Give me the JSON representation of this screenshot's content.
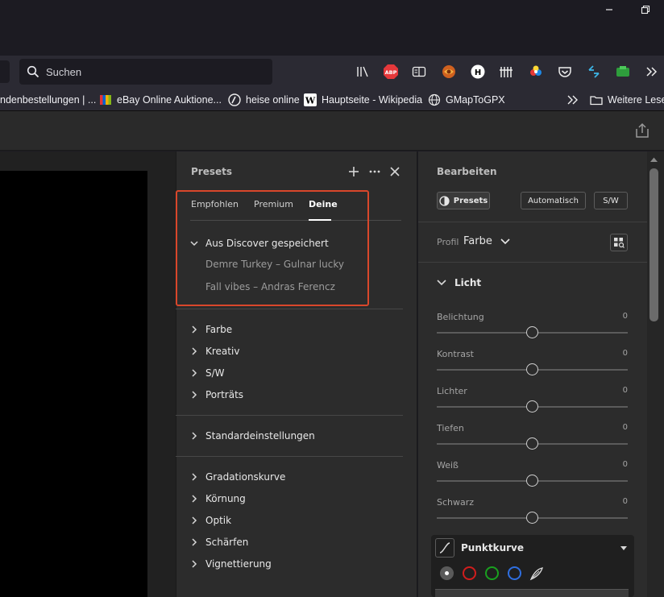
{
  "browser": {
    "window_controls": [
      "minimize-icon",
      "restore-icon"
    ],
    "search": {
      "placeholder": "Suchen"
    },
    "toolbar_icons": [
      "library-icon",
      "adblock-plus-icon",
      "reader-view-icon",
      "extension-icon",
      "extension-h-icon",
      "extension-grid-icon",
      "extension-color-icon",
      "pocket-icon",
      "sync-icon",
      "extension-green-icon",
      "overflow-chevrons-icon"
    ],
    "bookmarks": [
      {
        "label": "ndenbestellungen | ...",
        "icon": "none"
      },
      {
        "label": "eBay Online Auktione...",
        "icon": "ebay-icon"
      },
      {
        "label": "heise online",
        "icon": "heise-icon"
      },
      {
        "label": "Hauptseite - Wikipedia",
        "icon": "wikipedia-icon"
      },
      {
        "label": "GMapToGPX",
        "icon": "globe-icon"
      },
      {
        "label": "Weitere Lesez",
        "icon": "folder-icon"
      }
    ]
  },
  "presets": {
    "title": "Presets",
    "tabs": [
      {
        "label": "Empfohlen",
        "active": false
      },
      {
        "label": "Premium",
        "active": false
      },
      {
        "label": "Deine",
        "active": true
      }
    ],
    "discover_group": {
      "label": "Aus Discover gespeichert",
      "items": [
        "Demre Turkey – Gulnar lucky",
        "Fall vibes – Andras Ferencz"
      ]
    },
    "groups_a": [
      "Farbe",
      "Kreativ",
      "S/W",
      "Porträts"
    ],
    "groups_b": [
      "Standardeinstellungen"
    ],
    "groups_c": [
      "Gradationskurve",
      "Körnung",
      "Optik",
      "Schärfen",
      "Vignettierung"
    ],
    "highlight_color": "#d9472b"
  },
  "edit": {
    "title": "Bearbeiten",
    "buttons": {
      "presets": "Presets",
      "auto": "Automatisch",
      "bw": "S/W"
    },
    "profile": {
      "label": "Profil",
      "value": "Farbe"
    },
    "light": {
      "title": "Licht",
      "sliders": [
        {
          "label": "Belichtung",
          "value": "0"
        },
        {
          "label": "Kontrast",
          "value": "0"
        },
        {
          "label": "Lichter",
          "value": "0"
        },
        {
          "label": "Tiefen",
          "value": "0"
        },
        {
          "label": "Weiß",
          "value": "0"
        },
        {
          "label": "Schwarz",
          "value": "0"
        }
      ]
    },
    "curve": {
      "title": "Punktkurve",
      "channels": [
        {
          "name": "rgb",
          "color": "#cfcfcf"
        },
        {
          "name": "red",
          "color": "#d01d1d"
        },
        {
          "name": "green",
          "color": "#19a01f"
        },
        {
          "name": "blue",
          "color": "#2f6fe0"
        }
      ]
    }
  }
}
